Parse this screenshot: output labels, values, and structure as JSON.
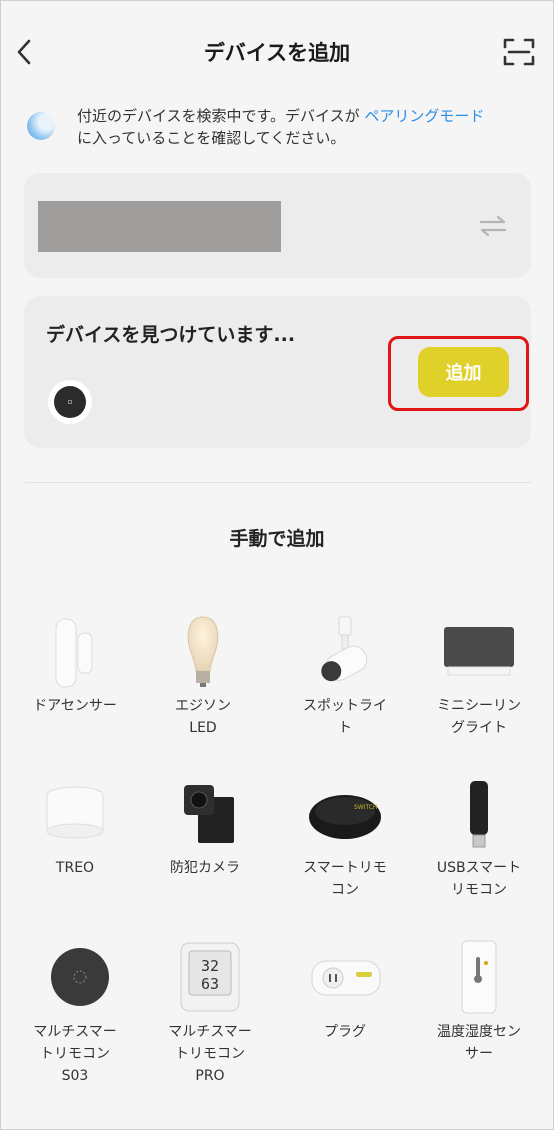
{
  "header": {
    "title": "デバイスを追加"
  },
  "info": {
    "text_before": "付近のデバイスを検索中です。デバイスが ",
    "link": "ペアリングモード",
    "text_after": "に入っていることを確認してください。"
  },
  "finding": {
    "title": "デバイスを見つけています...",
    "add_label": "追加"
  },
  "manual": {
    "title": "手動で追加",
    "items": [
      {
        "label": "ドアセンサー",
        "icon": "door-sensor-icon"
      },
      {
        "label": "エジソン\nLED",
        "icon": "edison-bulb-icon"
      },
      {
        "label": "スポットライ\nト",
        "icon": "spotlight-icon"
      },
      {
        "label": "ミニシーリン\nグライト",
        "icon": "mini-ceiling-light-icon"
      },
      {
        "label": "TREO",
        "icon": "treo-light-icon"
      },
      {
        "label": "防犯カメラ",
        "icon": "security-camera-icon"
      },
      {
        "label": "スマートリモ\nコン",
        "icon": "smart-remote-icon"
      },
      {
        "label": "USBスマート\nリモコン",
        "icon": "usb-remote-icon"
      },
      {
        "label": "マルチスマー\nトリモコン\nS03",
        "icon": "multi-remote-s03-icon"
      },
      {
        "label": "マルチスマー\nトリモコン\nPRO",
        "icon": "multi-remote-pro-icon"
      },
      {
        "label": "プラグ",
        "icon": "plug-icon"
      },
      {
        "label": "温度湿度セン\nサー",
        "icon": "thermo-hygrometer-icon"
      }
    ]
  },
  "colors": {
    "accent": "#e0d02a",
    "link": "#2d8ee8",
    "highlight": "#e01515"
  }
}
